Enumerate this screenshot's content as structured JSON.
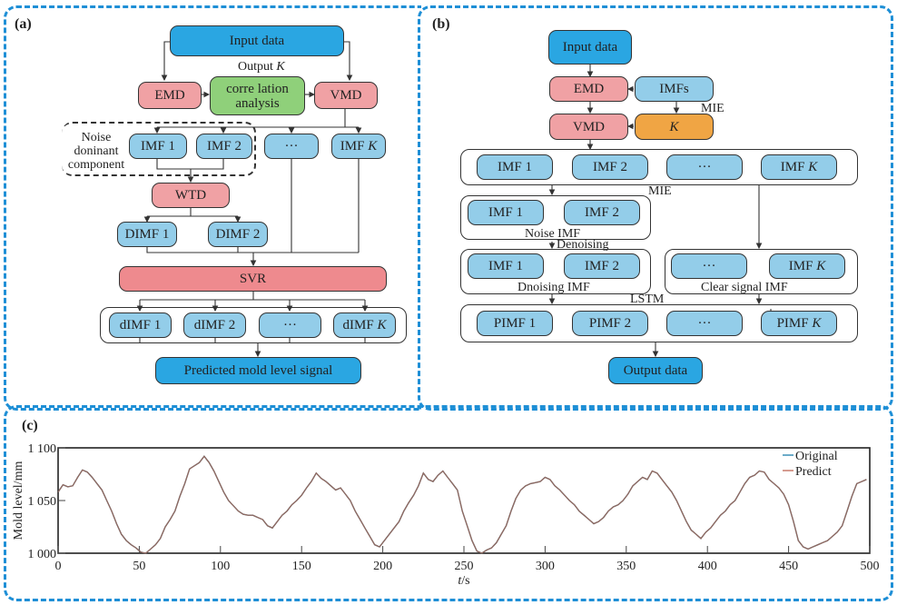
{
  "panels": {
    "a": {
      "label": "(a)",
      "input": "Input data",
      "output_k": "Output",
      "output_k_var": "K",
      "emd": "EMD",
      "correlation": "corre lation analysis",
      "vmd": "VMD",
      "noise_group": "Noise doninant component",
      "imf1": "IMF 1",
      "imf2": "IMF 2",
      "ellipsis": "···",
      "imfk": "IMF",
      "k_var": "K",
      "wtd": "WTD",
      "dimf1": "DIMF 1",
      "dimf2": "DIMF 2",
      "svr": "SVR",
      "dimf_small_1": "dIMF 1",
      "dimf_small_2": "dIMF 2",
      "dimf_small_k": "dIMF",
      "predicted": "Predicted mold level signal"
    },
    "b": {
      "label": "(b)",
      "input": "Input data",
      "emd": "EMD",
      "imfs": "IMFs",
      "mie1": "MIE",
      "vmd": "VMD",
      "k": "K",
      "imf1": "IMF 1",
      "imf2": "IMF 2",
      "ellipsis": "···",
      "imfk": "IMF",
      "k_var": "K",
      "mie2": "MIE",
      "noise_imf": "Noise IMF",
      "denoising": "Denoising",
      "dnoising_imf": "Dnoising IMF",
      "clear_signal_imf": "Clear signal IMF",
      "lstm": "LSTM",
      "pimf1": "PIMF 1",
      "pimf2": "PIMF 2",
      "pimfk": "PIMF",
      "output": "Output data"
    },
    "c": {
      "label": "(c)"
    }
  },
  "colors": {
    "panel_border": "#1e8fd6",
    "input_blue": "#2aa6e2",
    "imf_light_blue": "#93cde9",
    "decomp_pink": "#f0a1a4",
    "svr_red": "#ee8a8e",
    "correlation_green": "#8fd07a",
    "k_orange": "#f0a544",
    "original_line": "#3a8fb7",
    "predict_line": "#c97a6a"
  },
  "chart_data": {
    "type": "line",
    "title": "",
    "xlabel": "t/s",
    "ylabel": "Mold level/mm",
    "xlim": [
      0,
      500
    ],
    "ylim": [
      1000,
      1100
    ],
    "xticks": [
      "0",
      "50",
      "100",
      "150",
      "200",
      "250",
      "300",
      "350",
      "400",
      "450",
      "500"
    ],
    "yticks": [
      "1 000",
      "1 050",
      "1 100"
    ],
    "grid": false,
    "legend": {
      "placement": "top-right",
      "entries": [
        "Original",
        "Predict"
      ]
    },
    "x": [
      0,
      3,
      6,
      9,
      12,
      15,
      18,
      21,
      24,
      27,
      30,
      33,
      36,
      39,
      42,
      45,
      48,
      51,
      54,
      57,
      60,
      63,
      66,
      69,
      72,
      75,
      78,
      81,
      84,
      87,
      90,
      93,
      96,
      99,
      102,
      105,
      108,
      111,
      114,
      117,
      120,
      123,
      126,
      129,
      132,
      135,
      138,
      141,
      144,
      147,
      150,
      153,
      156,
      159,
      162,
      165,
      168,
      171,
      174,
      177,
      180,
      183,
      186,
      189,
      192,
      195,
      198,
      201,
      204,
      207,
      210,
      213,
      216,
      219,
      222,
      225,
      228,
      231,
      234,
      237,
      240,
      243,
      246,
      249,
      252,
      255,
      258,
      261,
      264,
      267,
      270,
      273,
      276,
      279,
      282,
      285,
      288,
      291,
      294,
      297,
      300,
      303,
      306,
      309,
      312,
      315,
      318,
      321,
      324,
      327,
      330,
      333,
      336,
      339,
      342,
      345,
      348,
      351,
      354,
      357,
      360,
      363,
      366,
      369,
      372,
      375,
      378,
      381,
      384,
      387,
      390,
      393,
      396,
      399,
      402,
      405,
      408,
      411,
      414,
      417,
      420,
      423,
      426,
      429,
      432,
      435,
      438,
      441,
      444,
      447,
      450,
      453,
      456,
      459,
      462,
      465,
      468,
      471,
      474,
      477,
      480,
      483,
      486,
      489,
      492,
      495,
      498
    ],
    "series": [
      {
        "name": "Original",
        "values": [
          1058,
          1065,
          1063,
          1064,
          1072,
          1079,
          1077,
          1072,
          1066,
          1060,
          1050,
          1040,
          1028,
          1018,
          1012,
          1008,
          1005,
          1001,
          1000,
          1004,
          1008,
          1014,
          1025,
          1032,
          1040,
          1054,
          1066,
          1080,
          1083,
          1086,
          1092,
          1086,
          1078,
          1068,
          1058,
          1050,
          1045,
          1040,
          1037,
          1036,
          1036,
          1034,
          1032,
          1026,
          1024,
          1030,
          1036,
          1040,
          1046,
          1050,
          1055,
          1062,
          1068,
          1076,
          1071,
          1068,
          1064,
          1060,
          1062,
          1056,
          1050,
          1040,
          1032,
          1024,
          1016,
          1008,
          1006,
          1012,
          1018,
          1024,
          1030,
          1040,
          1048,
          1055,
          1064,
          1076,
          1070,
          1068,
          1074,
          1078,
          1072,
          1066,
          1060,
          1040,
          1026,
          1012,
          1002,
          1000,
          1003,
          1005,
          1010,
          1018,
          1026,
          1040,
          1052,
          1060,
          1064,
          1066,
          1067,
          1068,
          1072,
          1070,
          1064,
          1060,
          1055,
          1050,
          1046,
          1040,
          1036,
          1032,
          1028,
          1030,
          1034,
          1040,
          1044,
          1046,
          1050,
          1056,
          1064,
          1068,
          1072,
          1070,
          1078,
          1076,
          1070,
          1064,
          1058,
          1050,
          1040,
          1030,
          1022,
          1018,
          1014,
          1020,
          1024,
          1030,
          1036,
          1040,
          1046,
          1050,
          1058,
          1066,
          1072,
          1074,
          1078,
          1077,
          1070,
          1066,
          1062,
          1056,
          1046,
          1030,
          1012,
          1006,
          1004,
          1006,
          1008,
          1010,
          1012,
          1016,
          1020,
          1026,
          1040,
          1054,
          1066,
          1068,
          1070,
          1066,
          1072,
          1068
        ]
      },
      {
        "name": "Predict",
        "values": [
          1058,
          1065,
          1063,
          1064,
          1072,
          1079,
          1077,
          1072,
          1066,
          1060,
          1050,
          1040,
          1028,
          1018,
          1012,
          1008,
          1005,
          1001,
          1000,
          1004,
          1008,
          1014,
          1025,
          1032,
          1040,
          1054,
          1066,
          1080,
          1083,
          1086,
          1092,
          1086,
          1078,
          1068,
          1058,
          1050,
          1045,
          1040,
          1037,
          1036,
          1036,
          1034,
          1032,
          1026,
          1024,
          1030,
          1036,
          1040,
          1046,
          1050,
          1055,
          1062,
          1068,
          1076,
          1071,
          1068,
          1064,
          1060,
          1062,
          1056,
          1050,
          1040,
          1032,
          1024,
          1016,
          1008,
          1006,
          1012,
          1018,
          1024,
          1030,
          1040,
          1048,
          1055,
          1064,
          1076,
          1070,
          1068,
          1074,
          1078,
          1072,
          1066,
          1060,
          1040,
          1026,
          1012,
          1002,
          1000,
          1003,
          1005,
          1010,
          1018,
          1026,
          1040,
          1052,
          1060,
          1064,
          1066,
          1067,
          1068,
          1072,
          1070,
          1064,
          1060,
          1055,
          1050,
          1046,
          1040,
          1036,
          1032,
          1028,
          1030,
          1034,
          1040,
          1044,
          1046,
          1050,
          1056,
          1064,
          1068,
          1072,
          1070,
          1078,
          1076,
          1070,
          1064,
          1058,
          1050,
          1040,
          1030,
          1022,
          1018,
          1014,
          1020,
          1024,
          1030,
          1036,
          1040,
          1046,
          1050,
          1058,
          1066,
          1072,
          1074,
          1078,
          1077,
          1070,
          1066,
          1062,
          1056,
          1046,
          1030,
          1012,
          1006,
          1004,
          1006,
          1008,
          1010,
          1012,
          1016,
          1020,
          1026,
          1040,
          1054,
          1066,
          1068,
          1070,
          1066,
          1072,
          1068
        ]
      }
    ]
  }
}
